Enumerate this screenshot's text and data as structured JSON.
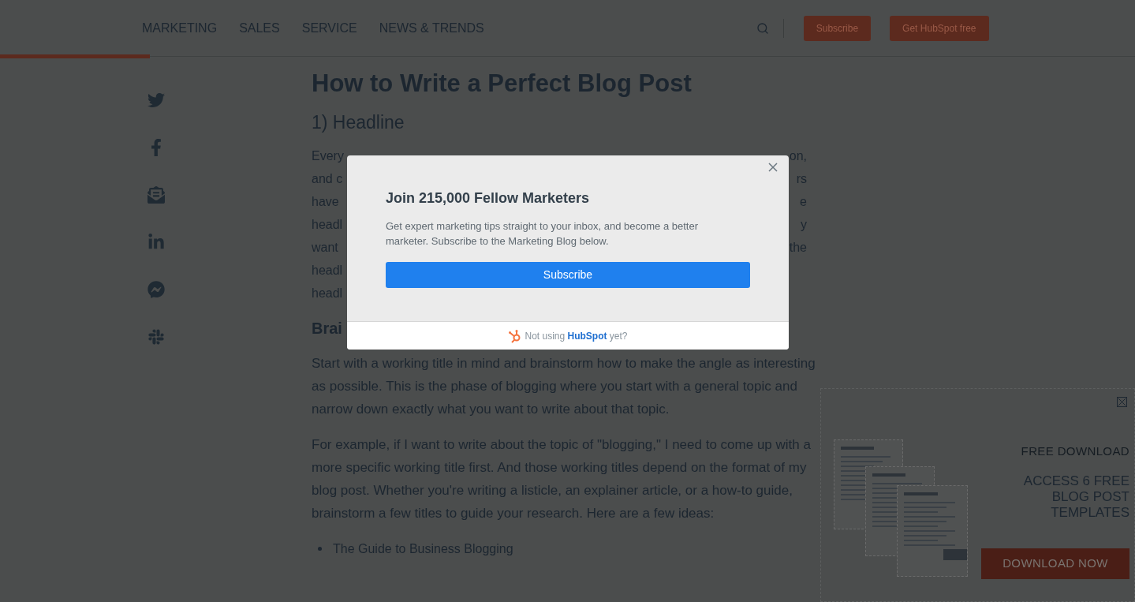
{
  "nav": {
    "links": [
      "MARKETING",
      "SALES",
      "SERVICE",
      "NEWS & TRENDS"
    ],
    "buttons": [
      "Subscribe",
      "Get HubSpot free"
    ]
  },
  "reading_progress": {
    "level": 0.132
  },
  "article": {
    "title": "How to Write a Perfect Blog Post",
    "subtitle": "1) Headline",
    "covered_paragraph": [
      {
        "left": "Every",
        "right": "on,"
      },
      {
        "left": "and c",
        "right": "rs"
      },
      {
        "left": "have",
        "right": "e"
      },
      {
        "left": "headl",
        "right": "y"
      },
      {
        "left": "want",
        "right": "the"
      },
      {
        "left": "headl"
      },
      {
        "left": "headl"
      }
    ],
    "covered_heading": "Brai",
    "paragraphs": [
      "Start with a working title in mind and brainstorm how to make the angle as interesting as possible. This is the phase of blogging where you start with a general topic and narrow down exactly what you want to write about that topic.",
      "For example, if I want to write about the topic of \"blogging,\" I need to come up with a more specific working title first. And those working titles depend on the format of my blog post. Whether you're writing a listicle, an explainer article, or a how-to guide, brainstorm a few titles to guide your research. Here are a few ideas:"
    ],
    "list": [
      "The Guide to Business Blogging"
    ]
  },
  "modal": {
    "title": "Join 215,000 Fellow Marketers",
    "body": "Get expert marketing tips straight to your inbox, and become a better marketer. Subscribe to the Marketing Blog below.",
    "button": "Subscribe",
    "footer": "Not using **HubSpot** yet?"
  },
  "slide_in": {
    "label": "FREE DOWNLOAD",
    "heading": "ACCESS 6 FREE BLOG POST TEMPLATES",
    "button": "DOWNLOAD NOW"
  }
}
